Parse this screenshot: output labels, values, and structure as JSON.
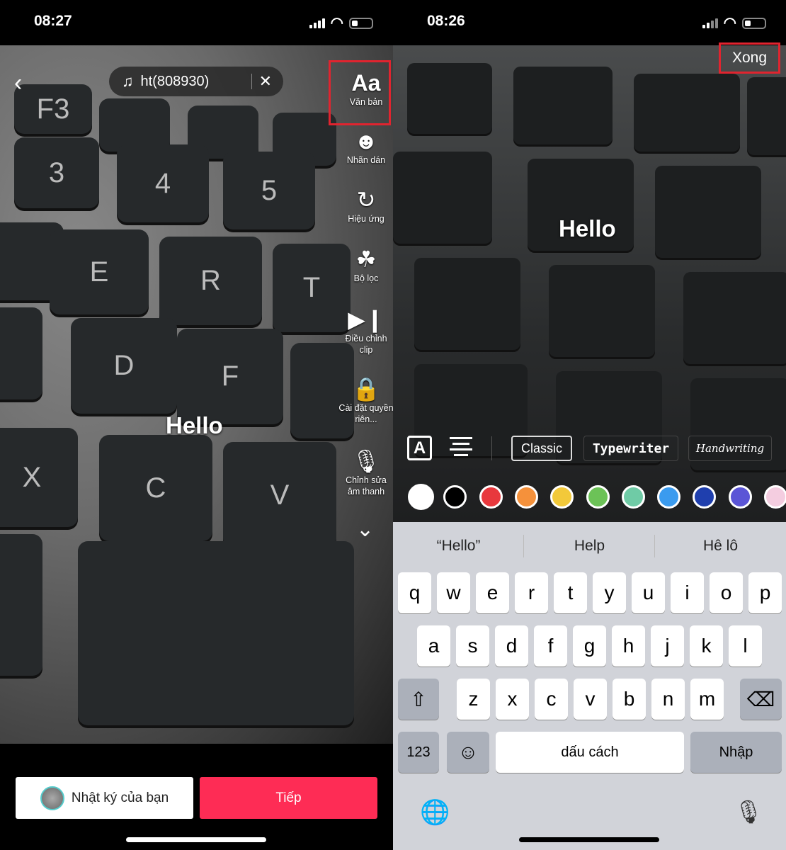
{
  "left": {
    "status": {
      "time": "08:27"
    },
    "music": {
      "title": "ht(808930)",
      "icon": "music-note-icon",
      "close": "✕"
    },
    "tools": [
      {
        "label": "Văn bản",
        "icon": "text-icon",
        "glyph": "Aa"
      },
      {
        "label": "Nhãn dán",
        "icon": "sticker-icon",
        "glyph": "☻"
      },
      {
        "label": "Hiệu ứng",
        "icon": "effects-icon",
        "glyph": "↻"
      },
      {
        "label": "Bộ lọc",
        "icon": "filters-icon",
        "glyph": "☘"
      },
      {
        "label": "Điều chỉnh clip",
        "icon": "adjust-clip-icon",
        "glyph": "▶❙"
      },
      {
        "label": "Cài đặt quyền riên...",
        "icon": "lock-icon",
        "glyph": "🔒"
      },
      {
        "label": "Chỉnh sửa âm thanh",
        "icon": "microphone-icon",
        "glyph": "🎙"
      }
    ],
    "more": "⌄",
    "overlay_text": "Hello",
    "diary_button": "Nhật ký của bạn",
    "next_button": "Tiếp"
  },
  "right": {
    "status": {
      "time": "08:26"
    },
    "done": "Xong",
    "overlay_text": "Hello",
    "fonts": [
      "Classic",
      "Typewriter",
      "Handwriting"
    ],
    "colors": [
      "#ffffff",
      "#000000",
      "#e8383d",
      "#f5913b",
      "#f2c93a",
      "#6cc257",
      "#6fcba6",
      "#3a9bef",
      "#1f3fae",
      "#5b55d6",
      "#f4cde0"
    ],
    "suggestions": [
      "“Hello”",
      "Help",
      "Hê lô"
    ],
    "keyboard": {
      "row1": [
        "q",
        "w",
        "e",
        "r",
        "t",
        "y",
        "u",
        "i",
        "o",
        "p"
      ],
      "row2": [
        "a",
        "s",
        "d",
        "f",
        "g",
        "h",
        "j",
        "k",
        "l"
      ],
      "row3": [
        "z",
        "x",
        "c",
        "v",
        "b",
        "n",
        "m"
      ],
      "shift": "⇧",
      "backspace": "⌫",
      "numbers": "123",
      "emoji": "☺",
      "space": "dấu cách",
      "return": "Nhập",
      "globe": "🌐",
      "mic": "🎙"
    }
  },
  "accent": "#fe2c55"
}
